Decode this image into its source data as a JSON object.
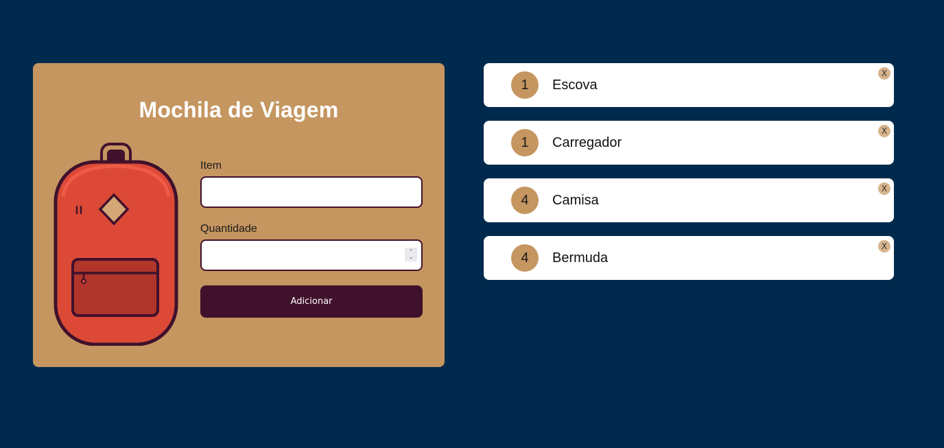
{
  "app": {
    "title": "Mochila de Viagem"
  },
  "form": {
    "item_label": "Item",
    "item_value": "",
    "quantity_label": "Quantidade",
    "quantity_value": "",
    "submit_label": "Adicionar"
  },
  "items": [
    {
      "quantity": "1",
      "name": "Escova",
      "remove_label": "X"
    },
    {
      "quantity": "1",
      "name": "Carregador",
      "remove_label": "X"
    },
    {
      "quantity": "4",
      "name": "Camisa",
      "remove_label": "X"
    },
    {
      "quantity": "4",
      "name": "Bermuda",
      "remove_label": "X"
    }
  ],
  "icons": {
    "backpack": "backpack-illustration",
    "spinner_up": "chevron-up-icon",
    "spinner_down": "chevron-down-icon",
    "remove": "close-icon"
  },
  "colors": {
    "background": "#002a4d",
    "card": "#c59660",
    "accent": "#40112c",
    "backpack_body": "#dc4a37",
    "white": "#ffffff"
  }
}
